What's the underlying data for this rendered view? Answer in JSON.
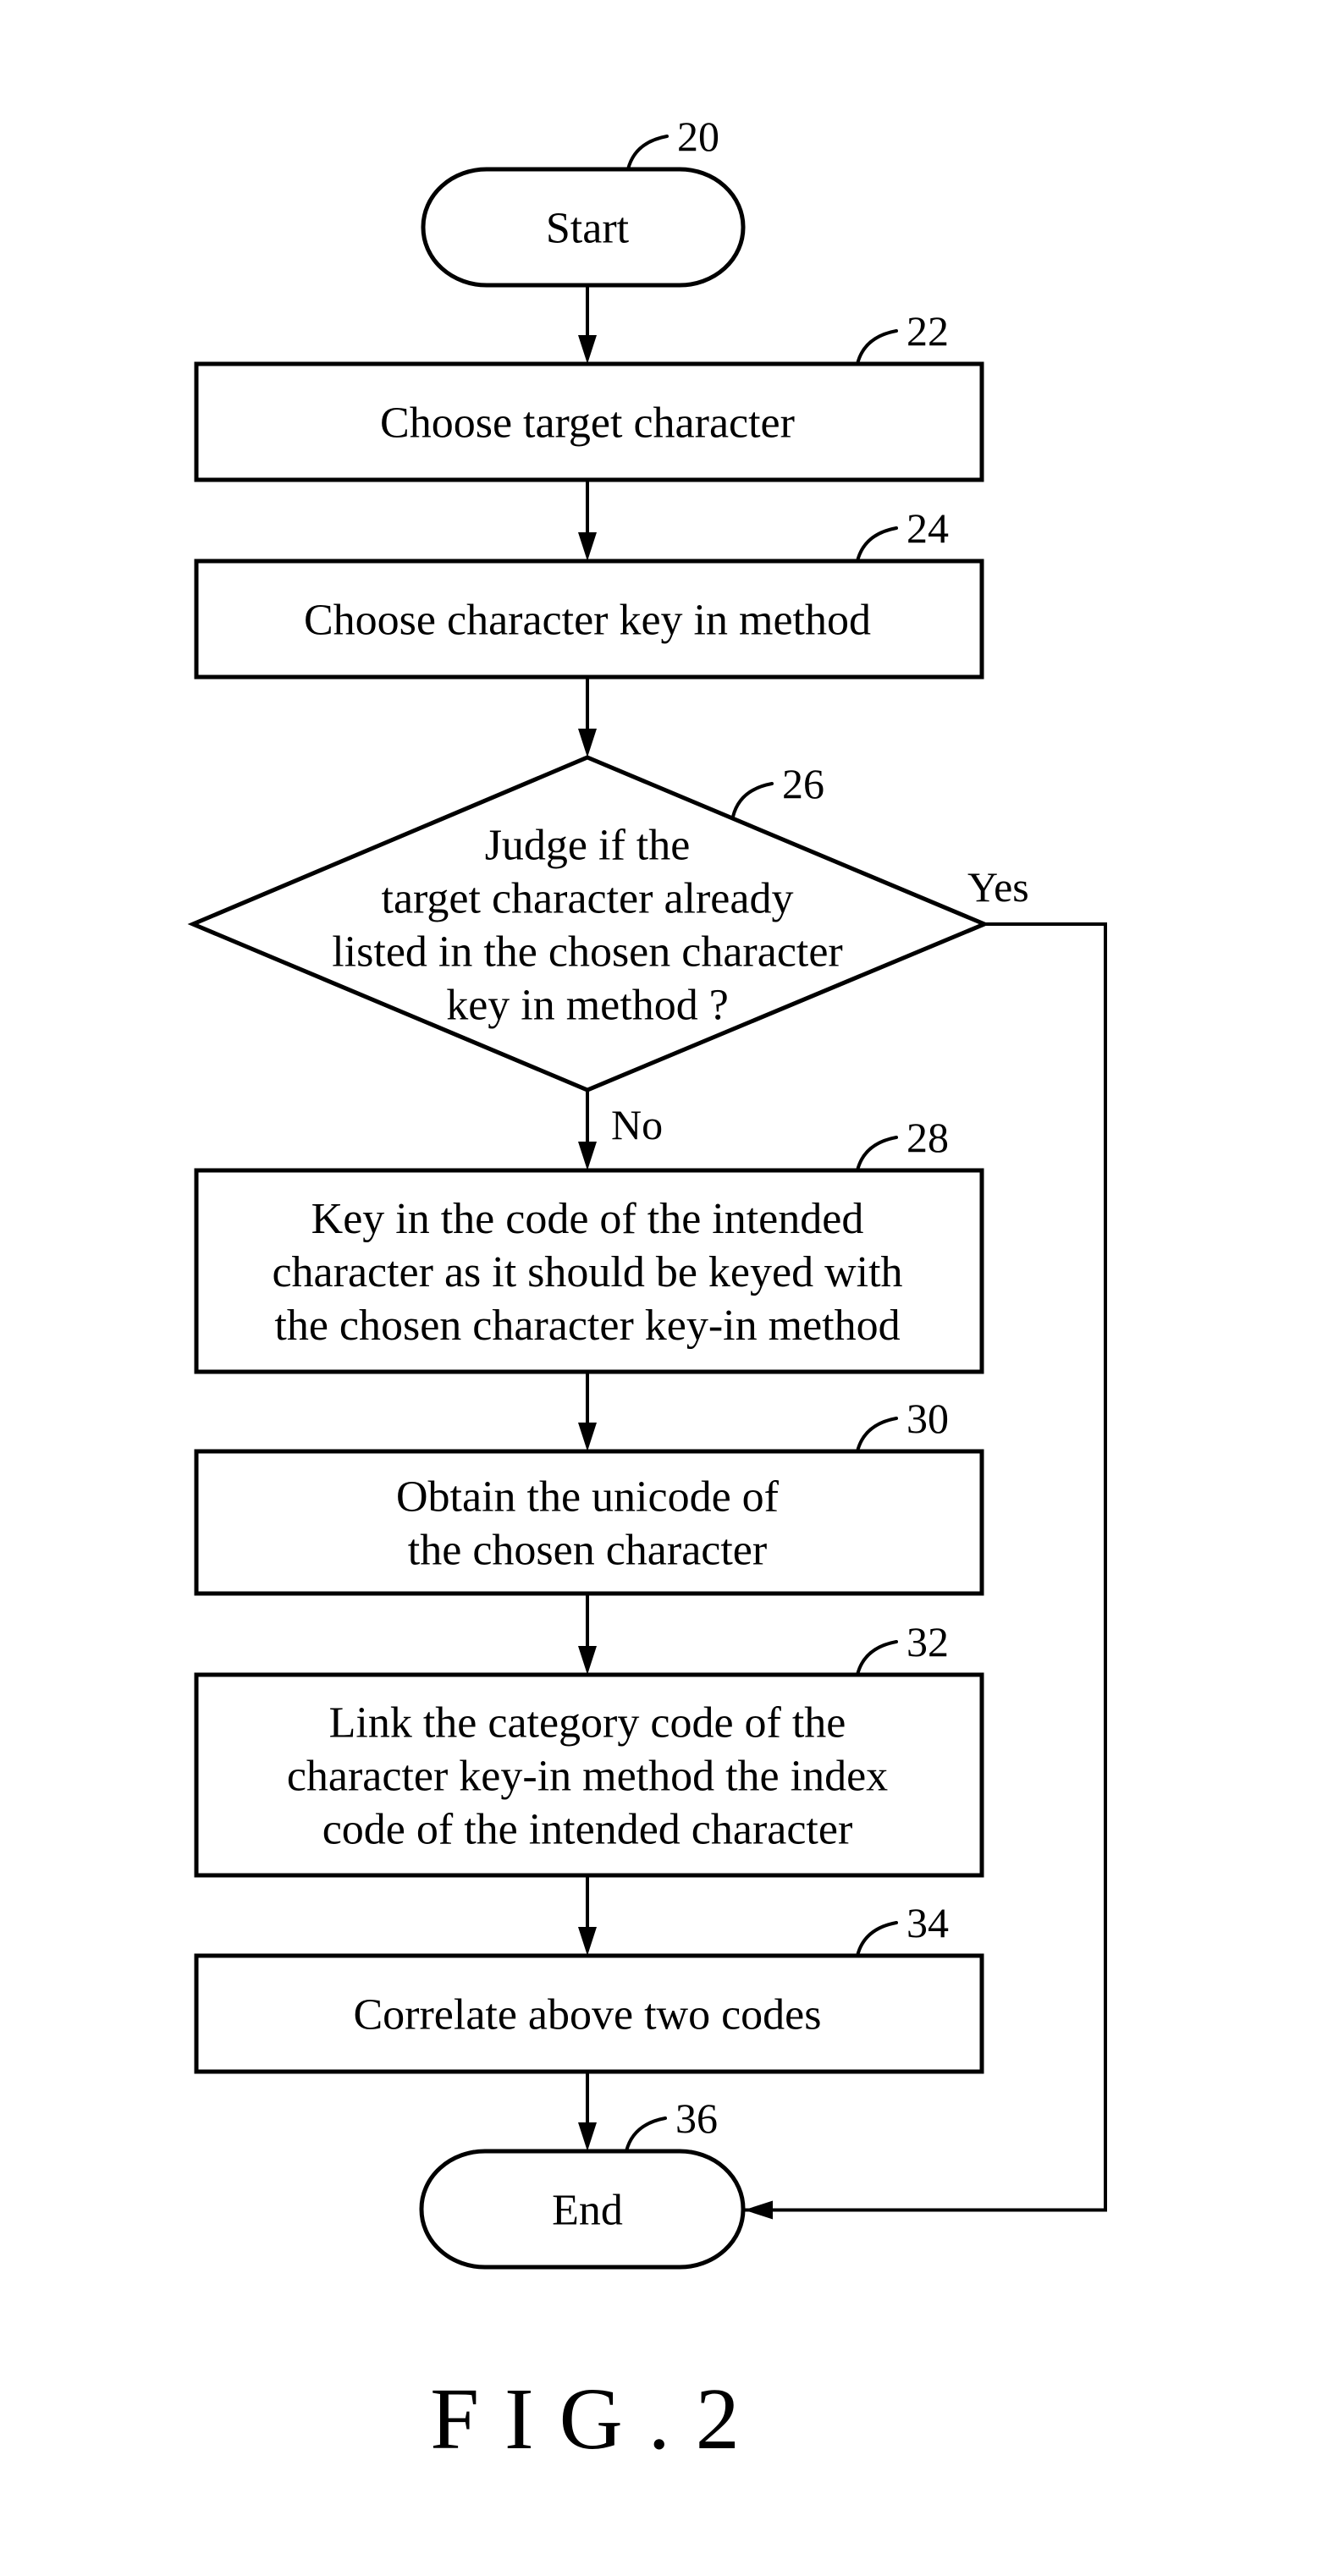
{
  "figure": {
    "caption": "FIG.2",
    "nodes": [
      {
        "id": "20",
        "type": "terminal",
        "ref": "20",
        "lines": [
          "Start"
        ]
      },
      {
        "id": "22",
        "type": "process",
        "ref": "22",
        "lines": [
          "Choose target character"
        ]
      },
      {
        "id": "24",
        "type": "process",
        "ref": "24",
        "lines": [
          "Choose character key in method"
        ]
      },
      {
        "id": "26",
        "type": "decision",
        "ref": "26",
        "lines": [
          "Judge if the",
          "target character already",
          "listed in the chosen character",
          "key in method ?"
        ]
      },
      {
        "id": "28",
        "type": "process",
        "ref": "28",
        "lines": [
          "Key in the code of the intended",
          "character as it should be keyed with",
          "the chosen character key-in method"
        ]
      },
      {
        "id": "30",
        "type": "process",
        "ref": "30",
        "lines": [
          "Obtain the unicode of",
          "the chosen character"
        ]
      },
      {
        "id": "32",
        "type": "process",
        "ref": "32",
        "lines": [
          "Link the category code of the",
          "character key-in method the index",
          "code of the intended character"
        ]
      },
      {
        "id": "34",
        "type": "process",
        "ref": "34",
        "lines": [
          "Correlate above two codes"
        ]
      },
      {
        "id": "36",
        "type": "terminal",
        "ref": "36",
        "lines": [
          "End"
        ]
      }
    ],
    "edges": [
      {
        "from": "20",
        "to": "22",
        "label": ""
      },
      {
        "from": "22",
        "to": "24",
        "label": ""
      },
      {
        "from": "24",
        "to": "26",
        "label": ""
      },
      {
        "from": "26",
        "to": "28",
        "label": "No"
      },
      {
        "from": "26",
        "to": "36",
        "label": "Yes"
      },
      {
        "from": "28",
        "to": "30",
        "label": ""
      },
      {
        "from": "30",
        "to": "32",
        "label": ""
      },
      {
        "from": "32",
        "to": "34",
        "label": ""
      },
      {
        "from": "34",
        "to": "36",
        "label": ""
      }
    ]
  }
}
